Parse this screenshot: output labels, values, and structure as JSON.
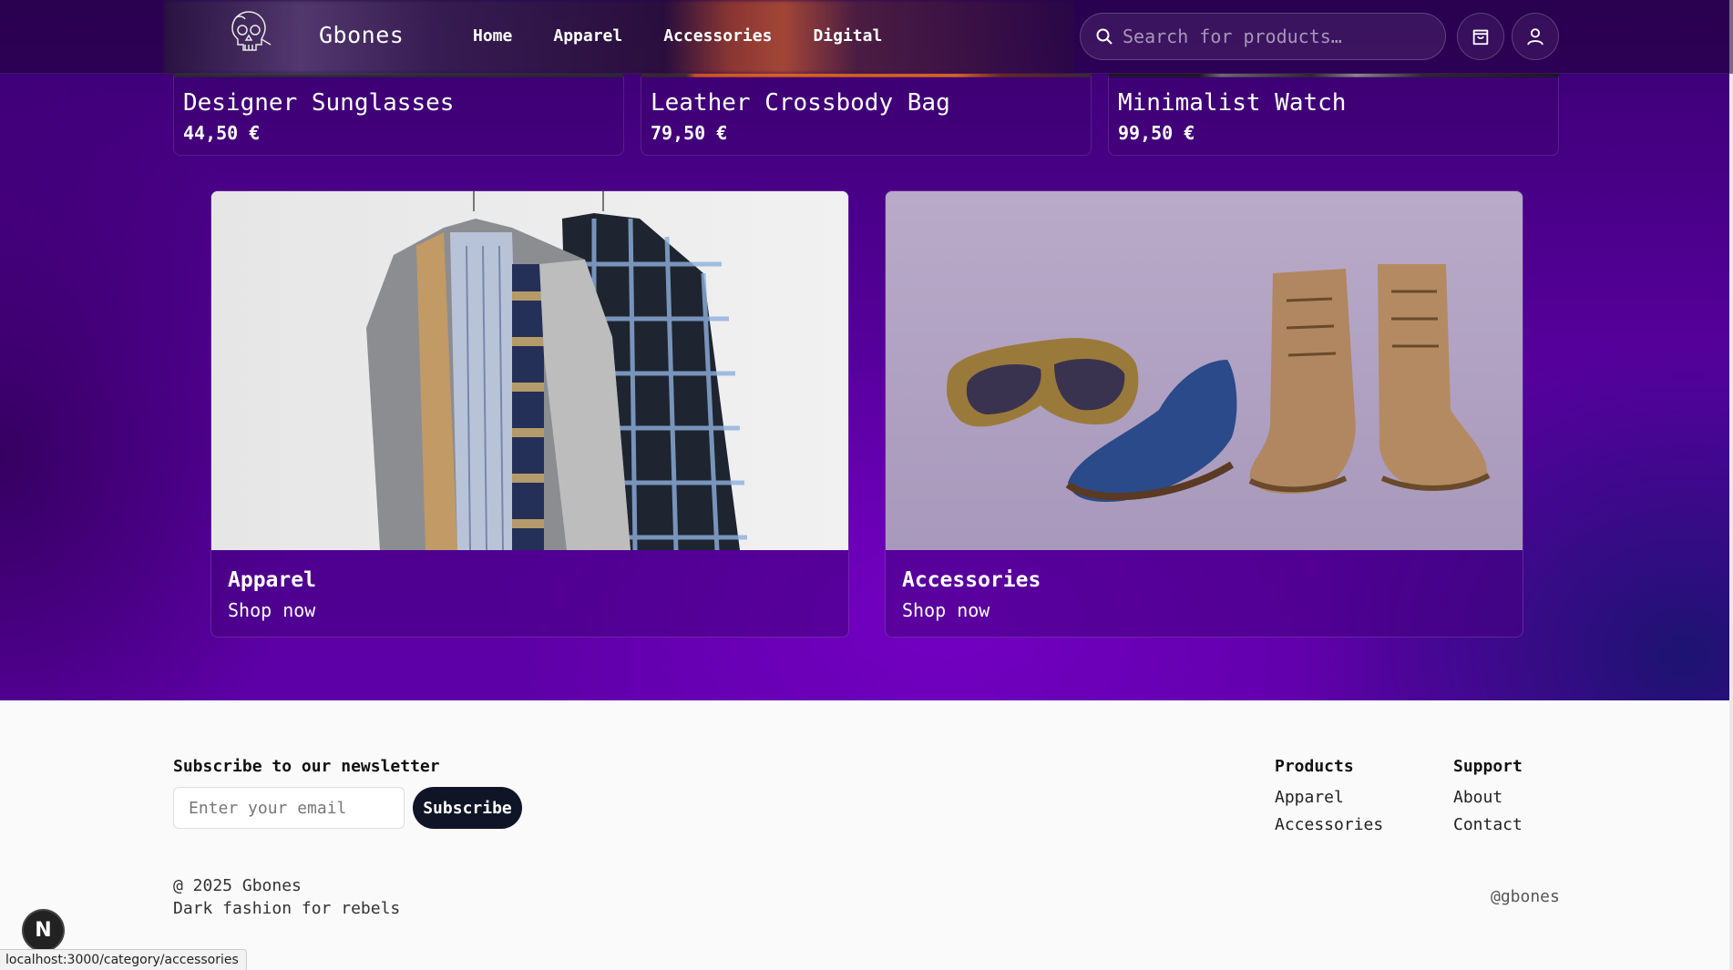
{
  "header": {
    "brand": "Gbones",
    "nav": [
      "Home",
      "Apparel",
      "Accessories",
      "Digital"
    ],
    "search_placeholder": "Search for products…",
    "icons": {
      "logo": "skull-logo-icon",
      "search": "search-icon",
      "cart": "shopping-bag-icon",
      "account": "user-icon"
    }
  },
  "products": [
    {
      "name": "Designer Sunglasses",
      "price": "44,50 €"
    },
    {
      "name": "Leather Crossbody Bag",
      "price": "79,50 €"
    },
    {
      "name": "Minimalist Watch",
      "price": "99,50 €"
    }
  ],
  "categories": [
    {
      "title": "Apparel",
      "cta": "Shop now"
    },
    {
      "title": "Accessories",
      "cta": "Shop now"
    }
  ],
  "footer": {
    "newsletter_title": "Subscribe to our newsletter",
    "email_placeholder": "Enter your email",
    "subscribe_label": "Subscribe",
    "products_title": "Products",
    "products_links": [
      "Apparel",
      "Accessories"
    ],
    "support_title": "Support",
    "support_links": [
      "About",
      "Contact"
    ],
    "copyright": "@ 2025 Gbones",
    "tagline": "Dark fashion for rebels",
    "social_handle": "@gbones"
  },
  "overlay": {
    "n_badge": "N",
    "status_url": "localhost:3000/category/accessories"
  },
  "colors": {
    "hero_purple": "#5e00a8",
    "header_dark": "#1e0037",
    "subscribe_bg": "#0f1526",
    "footer_bg": "#fafafa"
  }
}
